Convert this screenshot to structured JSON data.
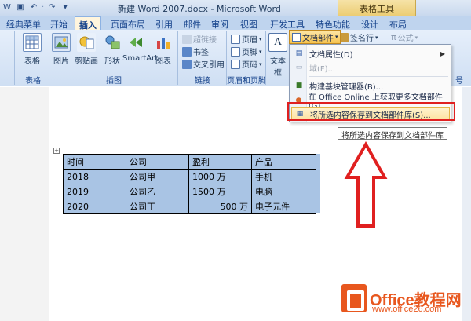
{
  "titlebar": {
    "title": "新建 Word 2007.docx - Microsoft Word",
    "tools_tab": "表格工具"
  },
  "tabs": [
    "经典菜单",
    "开始",
    "插入",
    "页面布局",
    "引用",
    "邮件",
    "审阅",
    "视图",
    "开发工具",
    "特色功能",
    "设计",
    "布局"
  ],
  "active_tab": "插入",
  "ribbon": {
    "table_label": "表格",
    "table_group": "表格",
    "picture": "图片",
    "clipart": "剪贴画",
    "shapes": "形状",
    "smartart": "SmartArt",
    "chart": "图表",
    "illustrations_group": "插图",
    "hyperlink": "超链接",
    "bookmark": "书签",
    "crossref": "交叉引用",
    "links_group": "链接",
    "header": "页眉",
    "footer": "页脚",
    "pagenum": "页码",
    "header_footer_group": "页眉和页脚",
    "textbox": "文本框",
    "docparts": "文档部件",
    "signature": "签名行",
    "equation": "公式",
    "symbol_group_partial": "号"
  },
  "menu": {
    "items": [
      {
        "label": "文档属性(D)",
        "has_arrow": true,
        "disabled": false
      },
      {
        "label": "域(F)...",
        "has_arrow": false,
        "disabled": true
      },
      {
        "label": "构建基块管理器(B)...",
        "has_arrow": false,
        "disabled": false
      },
      {
        "label": "在 Office Online 上获取更多文档部件(G)...",
        "has_arrow": false,
        "disabled": false
      },
      {
        "label": "将所选内容保存到文档部件库(S)...",
        "has_arrow": false,
        "disabled": false
      }
    ]
  },
  "tooltip": "将所选内容保存到文档部件库",
  "table": {
    "headers": [
      "时间",
      "公司",
      "盈利",
      "产品"
    ],
    "rows": [
      [
        "2018",
        "公司甲",
        "1000 万",
        "手机"
      ],
      [
        "2019",
        "公司乙",
        "1500 万",
        "电脑"
      ],
      [
        "2020",
        "公司丁",
        "500 万",
        "电子元件"
      ]
    ]
  },
  "logo": {
    "text": "Office教程网",
    "url": "www.office26.com"
  },
  "colors": {
    "accent_red": "#e02020",
    "selection": "#a9c4e4",
    "ribbon_blue": "#cfdff3",
    "logo_orange": "#e8571e"
  }
}
